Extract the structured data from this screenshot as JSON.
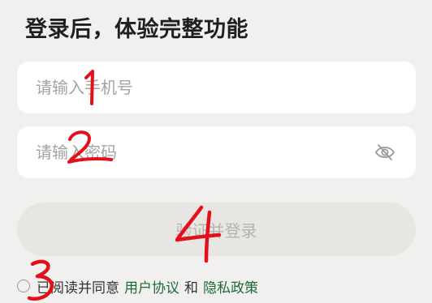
{
  "header": {
    "title": "登录后，体验完整功能"
  },
  "form": {
    "phone_placeholder": "请输入手机号",
    "password_placeholder": "请输入密码",
    "password_visibility_icon": "eye-off-icon",
    "submit_label": "验证并登录"
  },
  "agreement": {
    "prefix": "已阅读并同意",
    "user_agreement": "用户协议",
    "conjunction": "和",
    "privacy_policy": "隐私政策"
  },
  "annotations": {
    "mark_1": "1",
    "mark_2": "2",
    "mark_3": "3",
    "mark_4": "4"
  },
  "colors": {
    "background": "#f1f0ee",
    "field_background": "#ffffff",
    "button_disabled_bg": "#e7e6e2",
    "button_disabled_text": "#b4b3ae",
    "link": "#1c6b3a",
    "annotation_red": "#e3101a"
  }
}
